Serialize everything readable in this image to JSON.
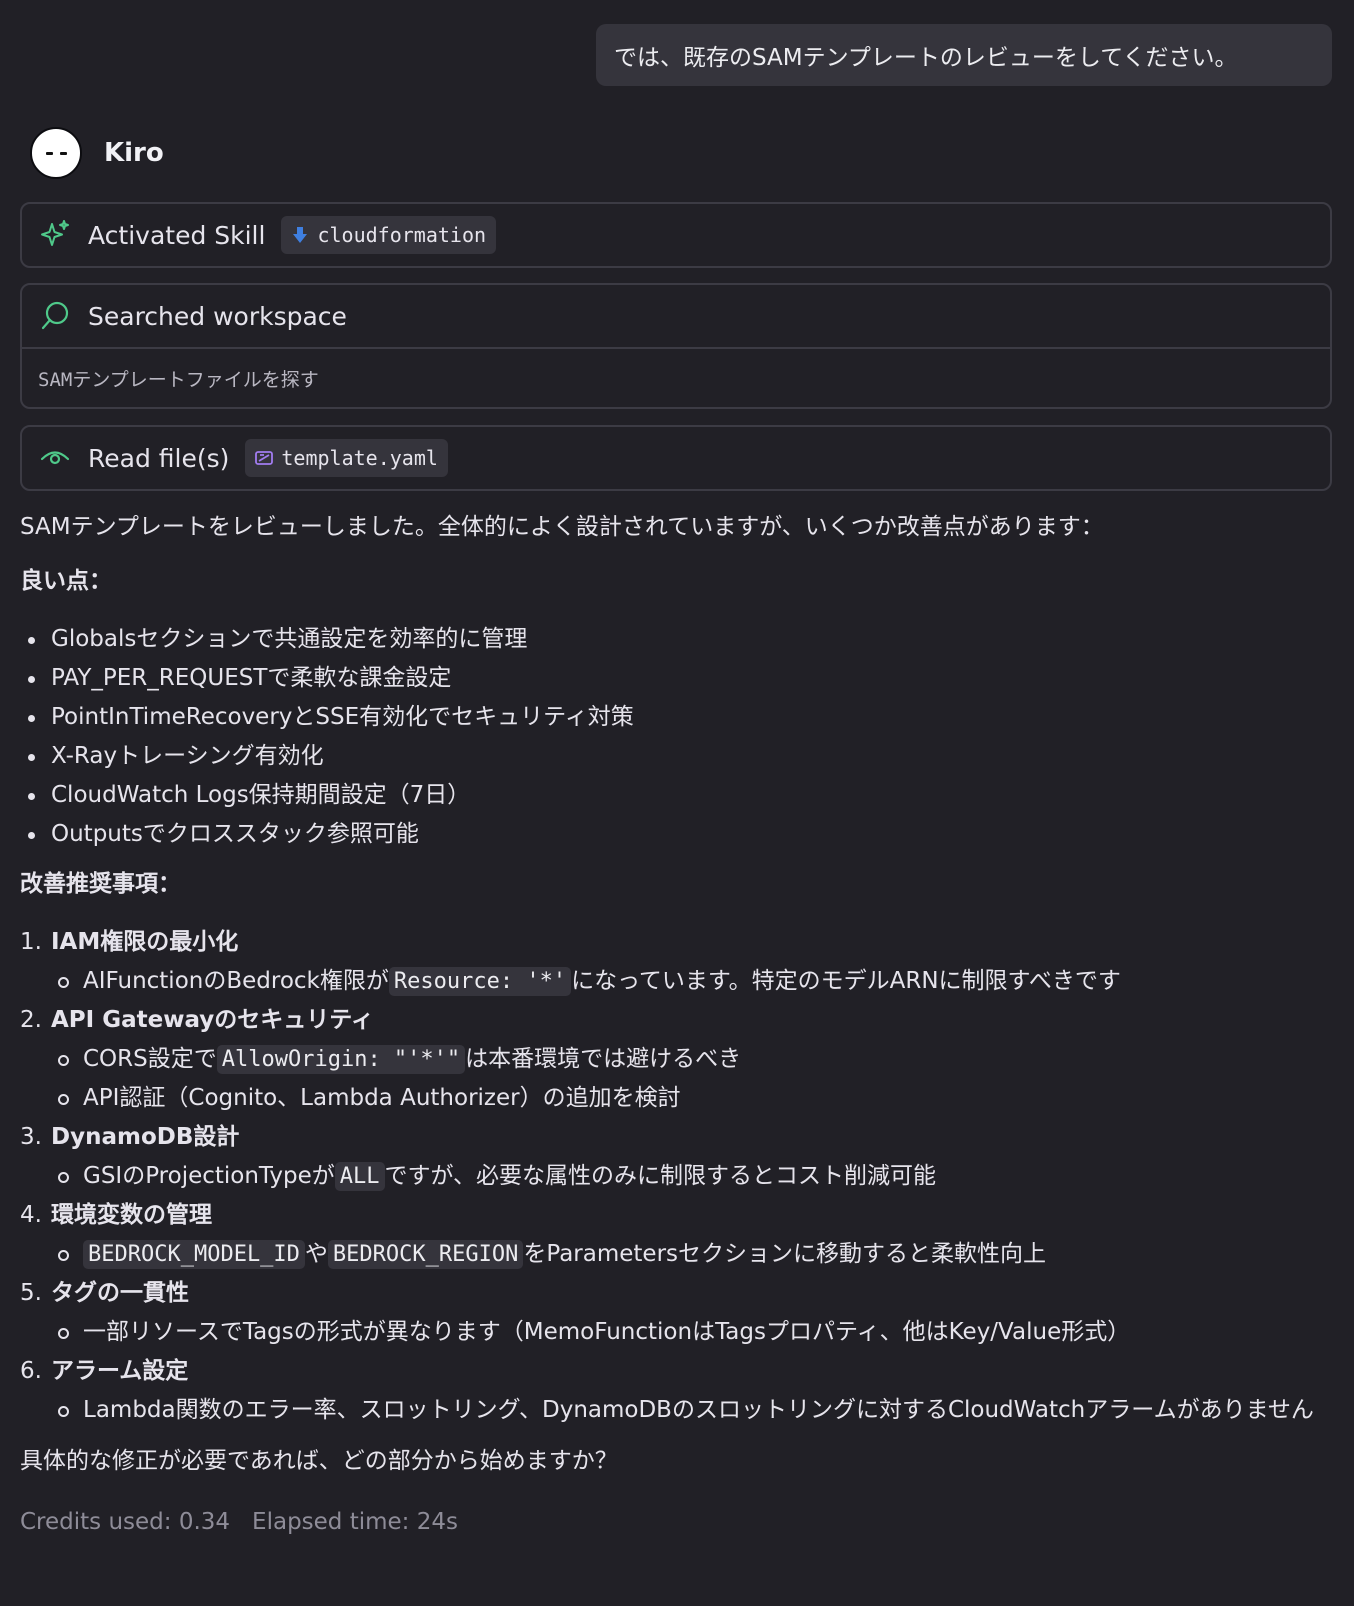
{
  "user_message": "では、既存のSAMテンプレートのレビューをしてください。",
  "agent": {
    "name": "Kiro"
  },
  "skill_card": {
    "title": "Activated Skill",
    "chip": "cloudformation",
    "icon": "sparkle-icon"
  },
  "search_card": {
    "title": "Searched workspace",
    "query": "SAMテンプレートファイルを探す",
    "icon": "search-icon"
  },
  "read_card": {
    "title": "Read file(s)",
    "chip": "template.yaml",
    "icon": "eye-icon"
  },
  "response": {
    "intro": "SAMテンプレートをレビューしました。全体的によく設計されていますが、いくつか改善点があります：",
    "good_heading": "良い点：",
    "good_points": [
      "Globalsセクションで共通設定を効率的に管理",
      "PAY_PER_REQUESTで柔軟な課金設定",
      "PointInTimeRecoveryとSSE有効化でセキュリティ対策",
      "X-Rayトレーシング有効化",
      "CloudWatch Logs保持期間設定（7日）",
      "Outputsでクロススタック参照可能"
    ],
    "improve_heading": "改善推奨事項：",
    "items": [
      {
        "num": "1.",
        "title": "IAM権限の最小化",
        "subs": [
          {
            "pre": "AIFunctionのBedrock権限が",
            "code": "Resource: '*'",
            "post": "になっています。特定のモデルARNに制限すべきです"
          }
        ]
      },
      {
        "num": "2.",
        "title": "API Gatewayのセキュリティ",
        "subs": [
          {
            "pre": "CORS設定で",
            "code": "AllowOrigin: \"'*'\"",
            "post": "は本番環境では避けるべき"
          },
          {
            "text": "API認証（Cognito、Lambda Authorizer）の追加を検討"
          }
        ]
      },
      {
        "num": "3.",
        "title": "DynamoDB設計",
        "subs": [
          {
            "pre": "GSIのProjectionTypeが",
            "code": "ALL",
            "post": "ですが、必要な属性のみに制限するとコスト削減可能"
          }
        ]
      },
      {
        "num": "4.",
        "title": "環境変数の管理",
        "subs": [
          {
            "code": "BEDROCK_MODEL_ID",
            "mid": "や",
            "code2": "BEDROCK_REGION",
            "post": "をParametersセクションに移動すると柔軟性向上"
          }
        ]
      },
      {
        "num": "5.",
        "title": "タグの一貫性",
        "subs": [
          {
            "text": "一部リソースでTagsの形式が異なります（MemoFunctionはTagsプロパティ、他はKey/Value形式）"
          }
        ]
      },
      {
        "num": "6.",
        "title": "アラーム設定",
        "subs": [
          {
            "text": "Lambda関数のエラー率、スロットリング、DynamoDBのスロットリングに対するCloudWatchアラームがありません"
          }
        ]
      }
    ],
    "closing": "具体的な修正が必要であれば、どの部分から始めますか？"
  },
  "footer": {
    "credits": "Credits used: 0.34",
    "elapsed": "Elapsed time: 24s"
  },
  "colors": {
    "background": "#212026",
    "card_border": "#3c3b44",
    "accent_green": "#4fc98a",
    "accent_blue": "#3f7fe0",
    "accent_purple": "#a27cf0"
  }
}
